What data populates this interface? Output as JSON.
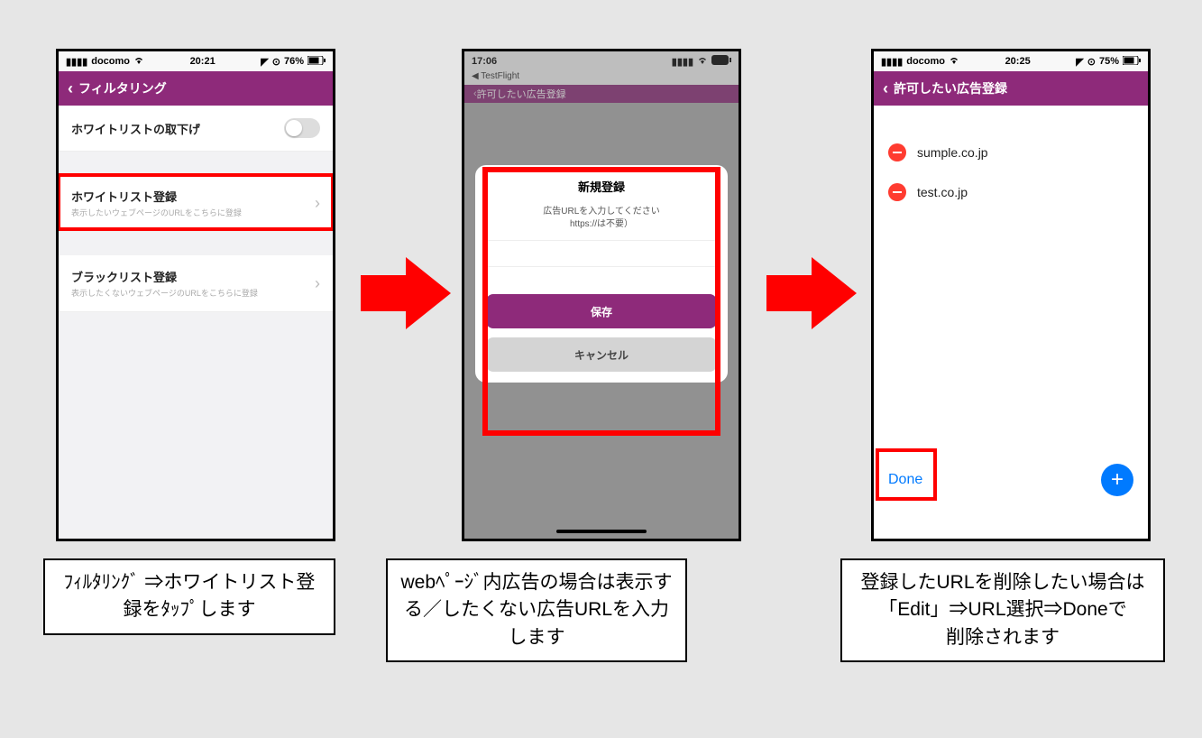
{
  "phone1": {
    "status": {
      "carrier": "docomo",
      "time": "20:21",
      "battery": "76%"
    },
    "nav_title": "フィルタリング",
    "row_toggle": "ホワイトリストの取下げ",
    "row_whitelist": {
      "title": "ホワイトリスト登録",
      "sub": "表示したいウェブページのURLをこちらに登録"
    },
    "row_blacklist": {
      "title": "ブラックリスト登録",
      "sub": "表示したくないウェブページのURLをこちらに登録"
    }
  },
  "phone2": {
    "status": {
      "time": "17:06"
    },
    "testflight": "◀ TestFlight",
    "partial_nav": "許可したい広告登録",
    "modal": {
      "title": "新規登録",
      "hint1": "広告URLを入力してください",
      "hint2": "https://は不要）",
      "save": "保存",
      "cancel": "キャンセル"
    }
  },
  "phone3": {
    "status": {
      "carrier": "docomo",
      "time": "20:25",
      "battery": "75%"
    },
    "nav_title": "許可したい広告登録",
    "items": [
      "sumple.co.jp",
      "test.co.jp"
    ],
    "done": "Done"
  },
  "captions": {
    "c1": "ﾌｨﾙﾀﾘﾝｸﾞ ⇒ホワイトリスト登録をﾀｯﾌﾟします",
    "c2": "webﾍﾟｰｼﾞ内広告の場合は表示する／したくない広告URLを入力します",
    "c3": "登録したURLを削除したい場合は「Edit」⇒URL選択⇒Doneで\n削除されます"
  }
}
